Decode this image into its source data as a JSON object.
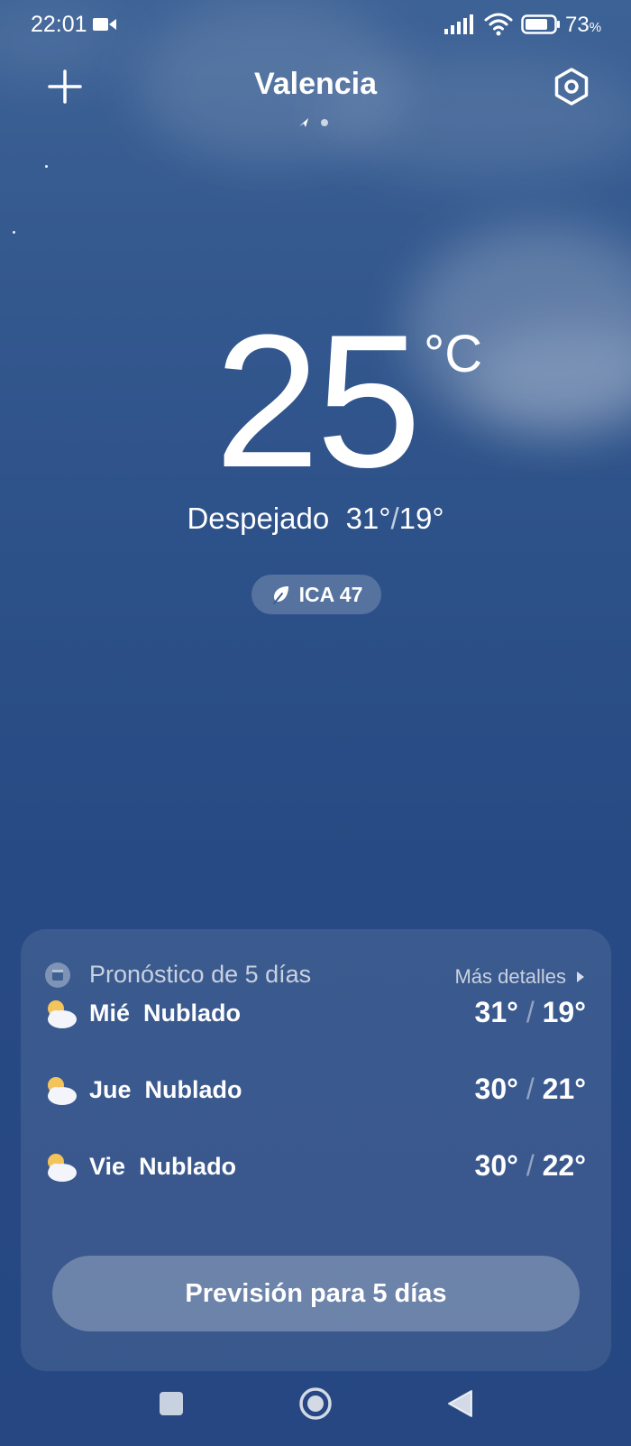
{
  "status_bar": {
    "time": "22:01",
    "battery_level": "73",
    "battery_unit": "%",
    "icons": [
      "video-camera-icon",
      "signal-icon",
      "wifi-icon",
      "battery-icon"
    ]
  },
  "header": {
    "city": "Valencia",
    "add_icon": "plus-icon",
    "settings_icon": "hexagon-settings-icon",
    "page_indicators": [
      "location-arrow-icon",
      "dot-icon"
    ]
  },
  "current": {
    "temperature": "25",
    "unit": "°C",
    "condition": "Despejado",
    "high": "31°",
    "low": "19°",
    "aqi_label": "ICA 47",
    "aqi_icon": "leaf-icon"
  },
  "forecast": {
    "title": "Pronóstico de 5 días",
    "details_label": "Más detalles",
    "days": [
      {
        "day": "Mié",
        "condition": "Nublado",
        "high": "31°",
        "low": "19°",
        "icon": "partly-cloudy-icon"
      },
      {
        "day": "Jue",
        "condition": "Nublado",
        "high": "30°",
        "low": "21°",
        "icon": "partly-cloudy-icon"
      },
      {
        "day": "Vie",
        "condition": "Nublado",
        "high": "30°",
        "low": "22°",
        "icon": "partly-cloudy-icon"
      }
    ],
    "button_label": "Previsión para 5 días"
  },
  "nav_bar": {
    "icons": [
      "recent-apps-icon",
      "home-icon",
      "back-icon"
    ]
  },
  "colors": {
    "background_top": "#3d6296",
    "background_bottom": "#264781",
    "text": "#ffffff"
  }
}
